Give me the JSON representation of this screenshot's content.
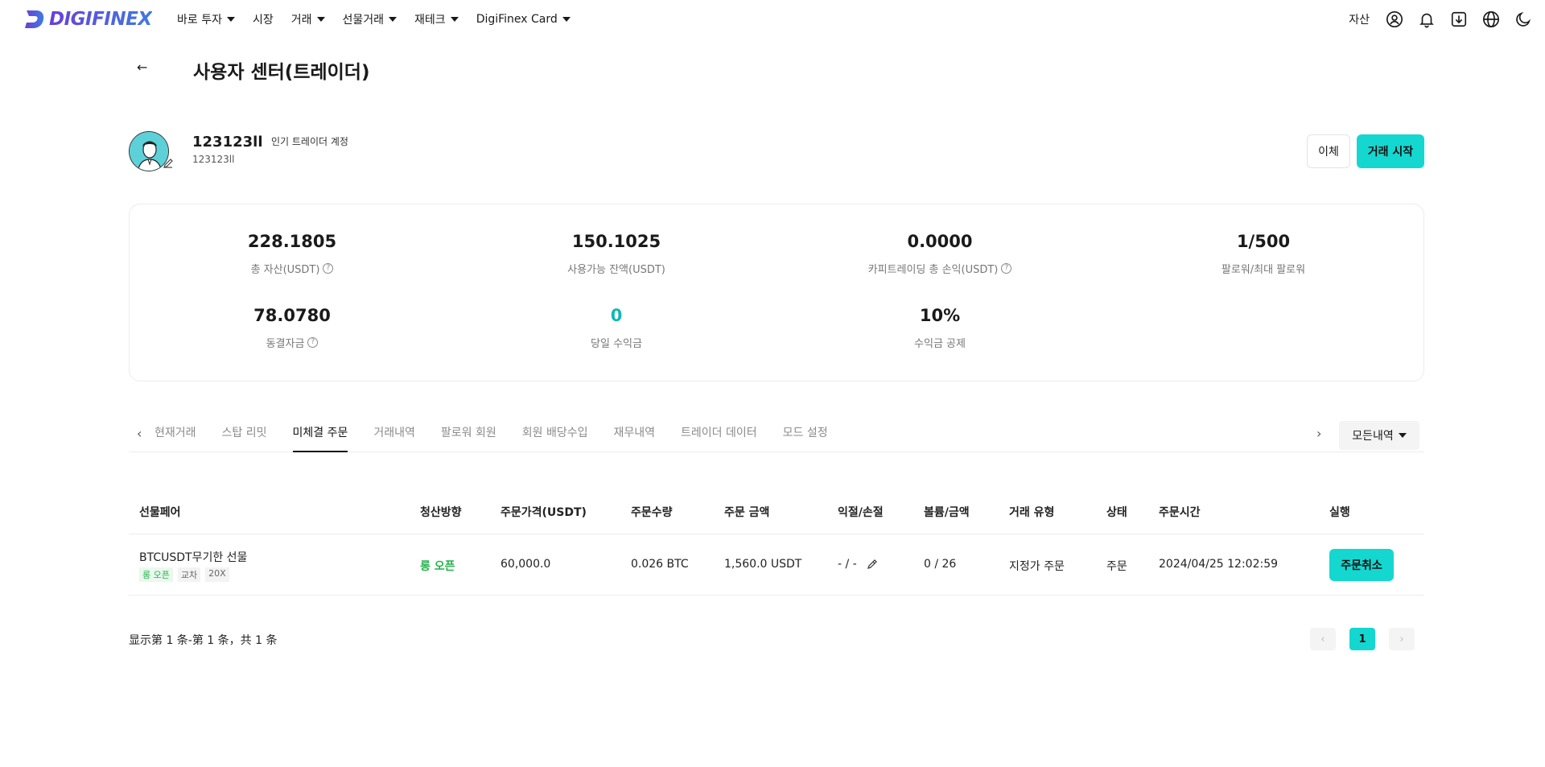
{
  "nav": {
    "logo_text": "DIGIFINEX",
    "items": [
      {
        "label": "바로 투자",
        "has_caret": true
      },
      {
        "label": "시장",
        "has_caret": false
      },
      {
        "label": "거래",
        "has_caret": true
      },
      {
        "label": "선물거래",
        "has_caret": true
      },
      {
        "label": "재테크",
        "has_caret": true
      },
      {
        "label": "DigiFinex Card",
        "has_caret": true
      }
    ],
    "assets_label": "자산",
    "icons": [
      "user-icon",
      "bell-icon",
      "download-icon",
      "globe-icon",
      "moon-icon"
    ]
  },
  "page": {
    "back_glyph": "←",
    "title": "사용자 센터(트레이더)"
  },
  "profile": {
    "username": "123123ll",
    "badge": "인기 트레이더 계정",
    "uid": "123123ll",
    "transfer_label": "이체",
    "start_label": "거래 시작"
  },
  "stats": {
    "total_assets": {
      "value": "228.1805",
      "label": "총 자산(USDT)"
    },
    "available_balance": {
      "value": "150.1025",
      "label": "사용가능 잔액(USDT)"
    },
    "copy_pnl": {
      "value": "0.0000",
      "label": "카피트레이딩 총 손익(USDT)"
    },
    "followers": {
      "value": "1/500",
      "label": "팔로워/최대 팔로워"
    },
    "frozen": {
      "value": "78.0780",
      "label": "동결자금"
    },
    "today_profit": {
      "value": "0",
      "label": "당일 수익금"
    },
    "profit_share": {
      "value": "10%",
      "label": "수익금 공제"
    }
  },
  "tabs": {
    "prev_glyph": "‹",
    "next_glyph": "›",
    "items": [
      "현재거래",
      "스탑 리밋",
      "미체결 주문",
      "거래내역",
      "팔로워 회원",
      "회원 배당수입",
      "재무내역",
      "트레이더 데이터",
      "모드 설정"
    ],
    "active_index": 2,
    "filter_label": "모든내역"
  },
  "table": {
    "headers": [
      "선물페어",
      "청산방향",
      "주문가격(USDT)",
      "주문수량",
      "주문 금액",
      "익절/손절",
      "볼륨/금액",
      "거래 유형",
      "상태",
      "주문시간",
      "실행"
    ],
    "row": {
      "pair": "BTCUSDT무기한 선물",
      "tag_direction": "롱 오픈",
      "tag_margin": "교차",
      "tag_leverage": "20X",
      "direction": "롱 오픈",
      "price": "60,000.0",
      "quantity": "0.026 BTC",
      "amount": "1,560.0 USDT",
      "tp_sl": "- / -",
      "volume": "0 / 26",
      "order_type": "지정가 주문",
      "status": "주문",
      "time": "2024/04/25 12:02:59",
      "action": "주문취소"
    }
  },
  "pagination": {
    "info": "显示第 1 条-第 1 条，共 1 条",
    "prev_glyph": "‹",
    "current_page": "1",
    "next_glyph": "›"
  },
  "colors": {
    "accent": "#14d7d0",
    "profit_teal": "#10b8b0",
    "long_green": "#23b34b"
  }
}
